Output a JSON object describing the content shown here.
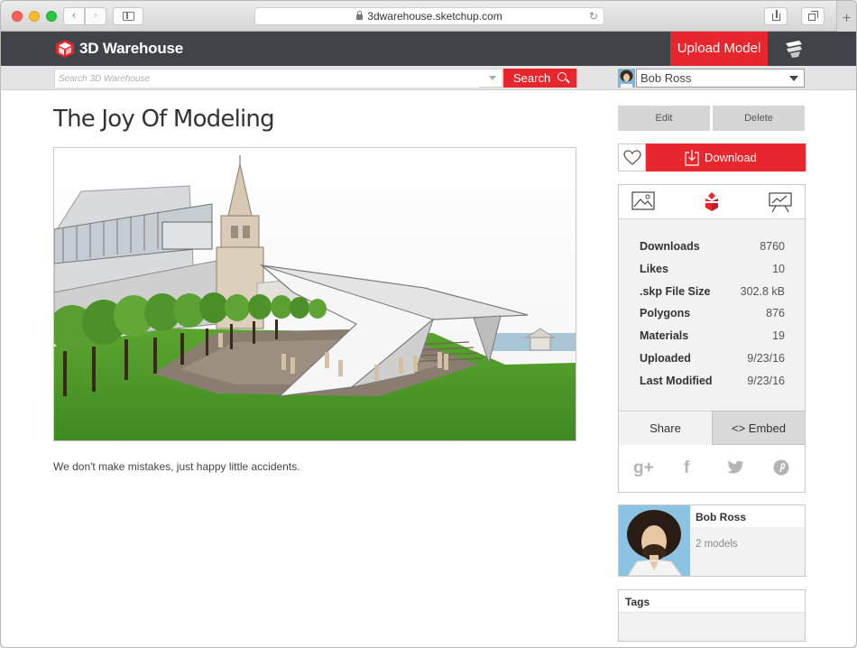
{
  "browser": {
    "url": "3dwarehouse.sketchup.com",
    "back_glyph": "‹",
    "forward_glyph": "›",
    "reload_glyph": "↻",
    "newtab_glyph": "+"
  },
  "header": {
    "logo_text": "3D Warehouse",
    "upload_label": "Upload Model",
    "brand_color": "#e8262d",
    "bar_color": "#404449"
  },
  "search": {
    "placeholder": "Search 3D Warehouse",
    "button_label": "Search"
  },
  "user_menu": {
    "selected": "Bob Ross"
  },
  "model": {
    "title": "The Joy Of Modeling",
    "description": "We don't make mistakes, just happy little accidents."
  },
  "actions": {
    "edit_label": "Edit",
    "delete_label": "Delete",
    "download_label": "Download"
  },
  "info": {
    "icons": [
      "image-icon",
      "sketchup-logo-icon",
      "presentation-icon"
    ],
    "stats": [
      {
        "label": "Downloads",
        "value": "8760"
      },
      {
        "label": "Likes",
        "value": "10"
      },
      {
        "label": ".skp File Size",
        "value": "302.8 kB"
      },
      {
        "label": "Polygons",
        "value": "876"
      },
      {
        "label": "Materials",
        "value": "19"
      },
      {
        "label": "Uploaded",
        "value": "9/23/16"
      },
      {
        "label": "Last Modified",
        "value": "9/23/16"
      }
    ],
    "share_tab": "Share",
    "embed_tab": "<> Embed",
    "social": [
      "g+",
      "f",
      "twitter",
      "p"
    ]
  },
  "author": {
    "name": "Bob Ross",
    "models": "2 models"
  },
  "tags": {
    "heading": "Tags"
  }
}
